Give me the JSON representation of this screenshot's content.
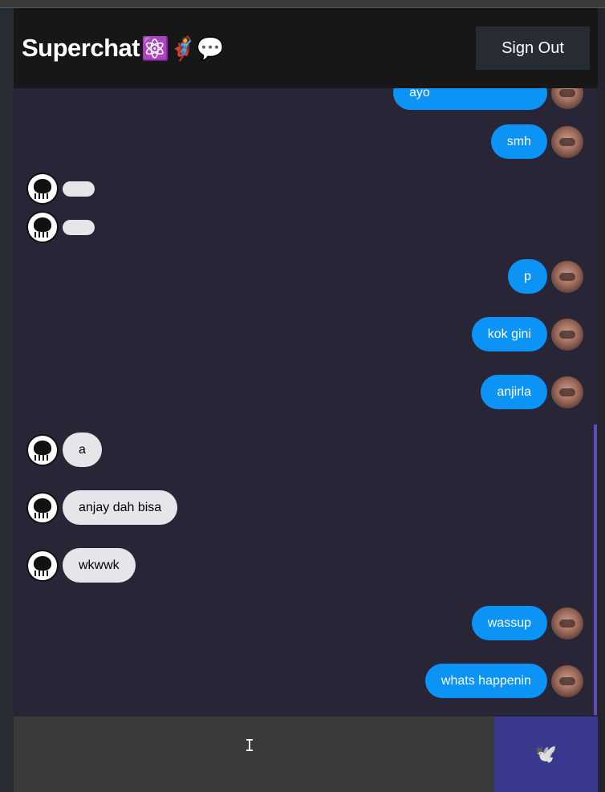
{
  "header": {
    "title": "Superchat",
    "title_emoji": "⚛️🦸💬",
    "signout_label": "Sign Out"
  },
  "messages": [
    {
      "type": "sent",
      "text": "ayo"
    },
    {
      "type": "sent",
      "text": "smh"
    },
    {
      "type": "received",
      "text": ""
    },
    {
      "type": "received",
      "text": ""
    },
    {
      "type": "sent",
      "text": "p"
    },
    {
      "type": "sent",
      "text": "kok gini"
    },
    {
      "type": "sent",
      "text": "anjirla"
    },
    {
      "type": "received",
      "text": "a"
    },
    {
      "type": "received",
      "text": "anjay dah bisa"
    },
    {
      "type": "received",
      "text": "wkwwk"
    },
    {
      "type": "sent",
      "text": "wassup"
    },
    {
      "type": "sent",
      "text": "whats happenin"
    }
  ],
  "composer": {
    "input_value": "",
    "send_icon": "🕊️"
  },
  "colors": {
    "sent_bubble": "#0b93f6",
    "received_bubble": "#e5e5ea",
    "header_bg": "#181717",
    "send_button": "#38388f"
  }
}
